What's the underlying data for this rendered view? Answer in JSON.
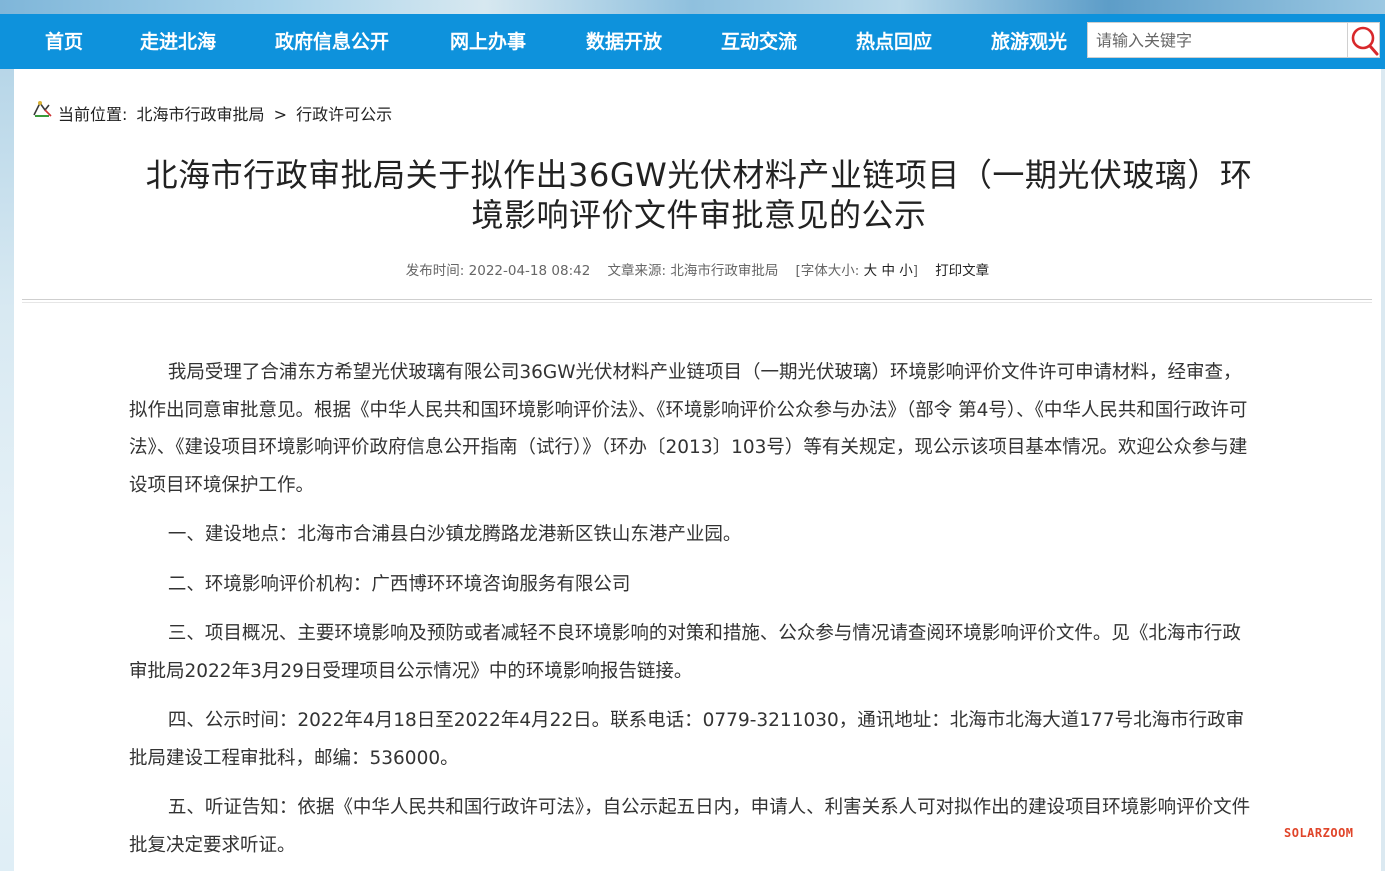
{
  "nav": {
    "items": [
      {
        "label": "首页"
      },
      {
        "label": "走进北海"
      },
      {
        "label": "政府信息公开"
      },
      {
        "label": "网上办事"
      },
      {
        "label": "数据开放"
      },
      {
        "label": "互动交流"
      },
      {
        "label": "热点回应"
      },
      {
        "label": "旅游观光"
      }
    ]
  },
  "search": {
    "placeholder": "请输入关键字",
    "icon": "search-icon"
  },
  "breadcrumb": {
    "prefix": "当前位置:",
    "level1": "北海市行政审批局",
    "separator": ">",
    "level2": "行政许可公示"
  },
  "article": {
    "title": "北海市行政审批局关于拟作出36GW光伏材料产业链项目（一期光伏玻璃）环境影响评价文件审批意见的公示",
    "meta": {
      "date_label": "发布时间:",
      "date": "2022-04-18 08:42",
      "source_label": "文章来源:",
      "source": "北海市行政审批局",
      "font_size_label": "[字体大小:",
      "font_large": "大",
      "font_medium": "中",
      "font_small": "小",
      "font_size_close": "]",
      "print": "打印文章"
    },
    "paragraphs": [
      "我局受理了合浦东方希望光伏玻璃有限公司36GW光伏材料产业链项目（一期光伏玻璃）环境影响评价文件许可申请材料，经审查，拟作出同意审批意见。根据《中华人民共和国环境影响评价法》、《环境影响评价公众参与办法》（部令 第4号）、《中华人民共和国行政许可法》、《建设项目环境影响评价政府信息公开指南（试行）》（环办〔2013〕103号）等有关规定，现公示该项目基本情况。欢迎公众参与建设项目环境保护工作。",
      "一、建设地点：北海市合浦县白沙镇龙腾路龙港新区铁山东港产业园。",
      "二、环境影响评价机构：广西博环环境咨询服务有限公司",
      "三、项目概况、主要环境影响及预防或者减轻不良环境影响的对策和措施、公众参与情况请查阅环境影响评价文件。见《北海市行政审批局2022年3月29日受理项目公示情况》中的环境影响报告链接。",
      "四、公示时间：2022年4月18日至2022年4月22日。联系电话：0779-3211030，通讯地址：北海市北海大道177号北海市行政审批局建设工程审批科，邮编：536000。",
      "五、听证告知：依据《中华人民共和国行政许可法》，自公示起五日内，申请人、利害关系人可对拟作出的建设项目环境影响评价文件批复决定要求听证。"
    ]
  },
  "watermark": "SOLARZOOM",
  "colors": {
    "nav_bg": "#0e92dc",
    "search_icon": "#d8282b",
    "watermark": "#e0452a"
  }
}
